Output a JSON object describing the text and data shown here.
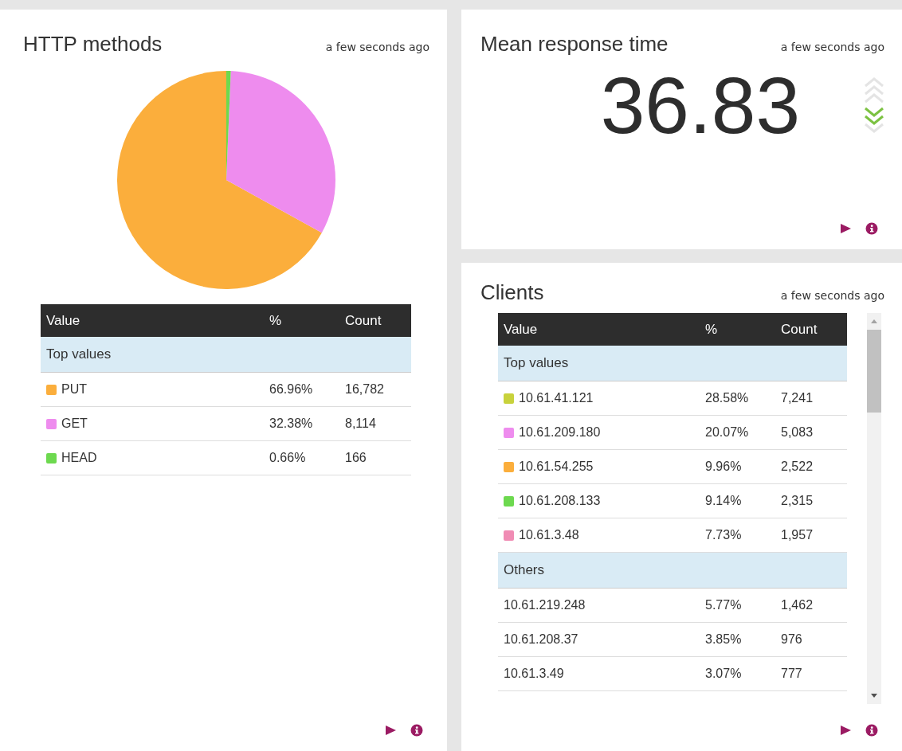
{
  "http_methods": {
    "title": "HTTP methods",
    "updated": "a few seconds ago",
    "chart_data": {
      "type": "pie",
      "values": [
        66.96,
        32.38,
        0.66
      ]
    },
    "table": {
      "columns": [
        "Value",
        "%",
        "Count"
      ],
      "groups": [
        {
          "title": "Top values",
          "rows": [
            {
              "value": "PUT",
              "percent": "66.96%",
              "count": "16,782",
              "color": "#fbae3c"
            },
            {
              "value": "GET",
              "percent": "32.38%",
              "count": "8,114",
              "color": "#ee8cee"
            },
            {
              "value": "HEAD",
              "percent": "0.66%",
              "count": "166",
              "color": "#6dd94f"
            }
          ]
        }
      ]
    }
  },
  "mean_response": {
    "title": "Mean response time",
    "updated": "a few seconds ago",
    "value": "36.83",
    "trending_down": true
  },
  "clients": {
    "title": "Clients",
    "updated": "a few seconds ago",
    "table": {
      "columns": [
        "Value",
        "%",
        "Count"
      ],
      "groups": [
        {
          "title": "Top values",
          "rows": [
            {
              "value": "10.61.41.121",
              "percent": "28.58%",
              "count": "7,241",
              "color": "#c8d23c"
            },
            {
              "value": "10.61.209.180",
              "percent": "20.07%",
              "count": "5,083",
              "color": "#ee8cee"
            },
            {
              "value": "10.61.54.255",
              "percent": "9.96%",
              "count": "2,522",
              "color": "#fbae3c"
            },
            {
              "value": "10.61.208.133",
              "percent": "9.14%",
              "count": "2,315",
              "color": "#6dd94f"
            },
            {
              "value": "10.61.3.48",
              "percent": "7.73%",
              "count": "1,957",
              "color": "#f08cb4"
            }
          ]
        },
        {
          "title": "Others",
          "rows": [
            {
              "value": "10.61.219.248",
              "percent": "5.77%",
              "count": "1,462"
            },
            {
              "value": "10.61.208.37",
              "percent": "3.85%",
              "count": "976"
            },
            {
              "value": "10.61.3.49",
              "percent": "3.07%",
              "count": "777"
            }
          ]
        }
      ]
    }
  }
}
